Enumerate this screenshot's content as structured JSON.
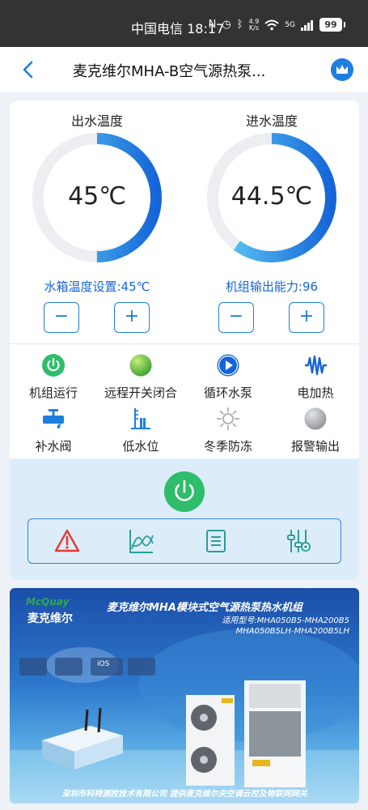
{
  "status_bar": {
    "time": "中国电信 18:17",
    "speed_value": "4.9",
    "speed_unit": "K/s",
    "network": "5G",
    "battery": "99"
  },
  "nav": {
    "title": "麦克维尔MHA-B空气源热泵..."
  },
  "outlet": {
    "label": "出水温度",
    "value": "45℃",
    "fill_fraction": 0.5
  },
  "inlet": {
    "label": "进水温度",
    "value": "44.5℃",
    "fill_fraction": 0.6
  },
  "tank_setting": {
    "label": "水箱温度设置:45℃",
    "minus": "−",
    "plus": "+"
  },
  "output_capacity": {
    "label": "机组输出能力:96",
    "minus": "−",
    "plus": "+"
  },
  "status_items": [
    {
      "label": "机组运行",
      "icon": "power-on-icon",
      "color": "#2ebd6b"
    },
    {
      "label": "远程开关闭合",
      "icon": "green-ball-icon",
      "color": "#59b530"
    },
    {
      "label": "循环水泵",
      "icon": "play-icon",
      "color": "#1565d8"
    },
    {
      "label": "电加热",
      "icon": "heater-icon",
      "color": "#1565d8"
    },
    {
      "label": "补水阀",
      "icon": "valve-icon",
      "color": "#1e7fe0"
    },
    {
      "label": "低水位",
      "icon": "water-level-icon",
      "color": "#1e7fe0"
    },
    {
      "label": "冬季防冻",
      "icon": "sun-icon",
      "color": "#b0b4ba"
    },
    {
      "label": "报警输出",
      "icon": "grey-ball-icon",
      "color": "#9a9ea4"
    }
  ],
  "toolbar": {
    "items": [
      "alarm-icon",
      "chart-icon",
      "list-icon",
      "settings-icon"
    ]
  },
  "banner": {
    "brand_en": "McQuay",
    "brand_cn": "麦克维尔",
    "title": "麦克维尔MHA模块式空气源热泵热水机组",
    "models_line1": "适用型号:MHA050B5-MHA200B5",
    "models_line2": "MHA050B5LH-MHA200B5LH",
    "ios": "iOS",
    "footer": "深圳市科特测控技术有限公司  提供麦克维尔央空调云控及物联网网关"
  }
}
